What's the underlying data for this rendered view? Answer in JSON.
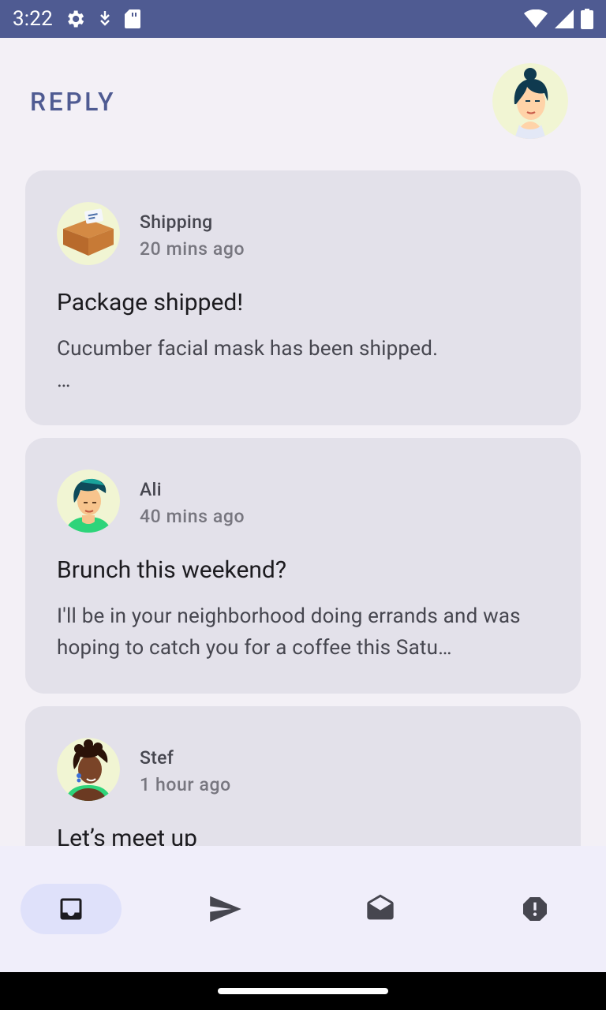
{
  "status_bar": {
    "time": "3:22",
    "left_icons": [
      "settings-icon",
      "download-icon",
      "sd-card-icon"
    ],
    "right_icons": [
      "wifi-icon",
      "cell-signal-icon",
      "battery-icon"
    ]
  },
  "header": {
    "logo": "REPLY",
    "profile_avatar": "profile-avatar"
  },
  "emails": [
    {
      "sender": "Shipping",
      "time": "20 mins ago",
      "subject": "Package shipped!",
      "preview": "Cucumber facial mask has been shipped.",
      "preview_more": "…",
      "avatar": "package-avatar"
    },
    {
      "sender": "Ali",
      "time": "40 mins ago",
      "subject": "Brunch this weekend?",
      "preview": "I'll be in your neighborhood doing errands and was hoping to catch you for a coffee this Satu…",
      "avatar": "ali-avatar"
    },
    {
      "sender": "Stef",
      "time": "1 hour ago",
      "subject": "Let’s meet up",
      "avatar": "stef-avatar"
    }
  ],
  "bottom_nav": {
    "items": [
      {
        "name": "inbox",
        "icon": "inbox-icon",
        "active": true
      },
      {
        "name": "sent",
        "icon": "send-icon",
        "active": false
      },
      {
        "name": "drafts",
        "icon": "drafts-icon",
        "active": false
      },
      {
        "name": "spam",
        "icon": "report-icon",
        "active": false
      }
    ]
  },
  "colors": {
    "accent": "#4f5b92",
    "card": "#e3e1ea",
    "background": "#f3f0f6",
    "nav_active": "#dfe1fa"
  }
}
